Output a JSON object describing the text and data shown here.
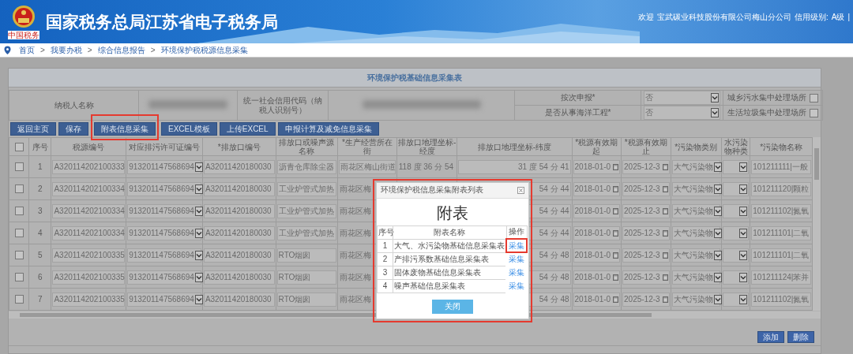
{
  "header": {
    "title": "国家税务总局江苏省电子税务局",
    "logo_caption": "中国税务",
    "welcome": "欢迎",
    "company": "宝武碳业科技股份有限公司梅山分公司",
    "credit_label": "信用级别:",
    "credit_level": "A级",
    "separator": "|"
  },
  "breadcrumb": [
    {
      "label": "首页"
    },
    {
      "separator": ">",
      "label": "我要办税"
    },
    {
      "separator": ">",
      "label": "综合信息报告"
    },
    {
      "separator": ">",
      "label": "环境保护税税源信息采集"
    }
  ],
  "form": {
    "title": "环境保护税基础信息采集表",
    "taxpayer_name_label": "纳税人名称",
    "credit_code_label": "统一社会信用代码（纳税人识别号）",
    "fields": [
      {
        "label": "按次申报*",
        "value": "否"
      },
      {
        "label": "是否从事海洋工程*",
        "value": "否"
      }
    ],
    "checks": [
      {
        "label": "城乡污水集中处理场所",
        "checked": false
      },
      {
        "label": "生活垃圾集中处理场所",
        "checked": false
      }
    ]
  },
  "toolbar": [
    {
      "label": "返回主页",
      "highlighted": false
    },
    {
      "label": "保存",
      "highlighted": false
    },
    {
      "label": "附表信息采集",
      "highlighted": true
    },
    {
      "label": "EXCEL模板",
      "highlighted": false
    },
    {
      "label": "上传EXCEL",
      "highlighted": false
    },
    {
      "label": "申报计算及减免信息采集",
      "highlighted": false
    }
  ],
  "table": {
    "all_checked": false,
    "columns": [
      "序号",
      "税源编号",
      "对应排污许可证编号",
      "*排放口编号",
      "排放口或噪声源名称",
      "*生产经营所在街",
      "排放口地理坐标-经度",
      "排放口地理坐标-纬度",
      "*税源有效期起",
      "*税源有效期止",
      "*污染物类别",
      "水污染物种类",
      "*污染物名称"
    ],
    "rows": [
      {
        "checked": false,
        "seq": "1",
        "source_id": "A320114202100333",
        "permit": "913201147568694",
        "outlet": "A32011420180030",
        "name": "沥青仓库除尘器",
        "street": "雨花区梅山街道",
        "longitude": "118 度 36 分 54",
        "latitude": "31 度 54 分 41",
        "start": "2018-01-0",
        "end": "2025-12-3",
        "category": "大气污染物",
        "pollutant": "101211111|一般"
      },
      {
        "checked": false,
        "seq": "2",
        "source_id": "A320114202100334",
        "permit": "913201147568694",
        "outlet": "A32011420180030",
        "name": "工业炉管式加热",
        "street": "雨花区梅",
        "latitude": "54 分 44",
        "start": "2018-01-0",
        "end": "2025-12-3",
        "category": "大气污染物",
        "pollutant": "101211120|颗粒"
      },
      {
        "checked": false,
        "seq": "3",
        "source_id": "A320114202100334",
        "permit": "913201147568694",
        "outlet": "A32011420180030",
        "name": "工业炉管式加热",
        "street": "雨花区梅",
        "latitude": "54 分 44",
        "start": "2018-01-0",
        "end": "2025-12-3",
        "category": "大气污染物",
        "pollutant": "101211102|氮氧"
      },
      {
        "checked": false,
        "seq": "4",
        "source_id": "A320114202100334",
        "permit": "913201147568694",
        "outlet": "A32011420180030",
        "name": "工业炉管式加热",
        "street": "雨花区梅",
        "latitude": "54 分 44",
        "start": "2018-01-0",
        "end": "2025-12-3",
        "category": "大气污染物",
        "pollutant": "101211101|二氧"
      },
      {
        "checked": false,
        "seq": "5",
        "source_id": "A320114202100335",
        "permit": "913201147568694",
        "outlet": "A32011420180030",
        "name": "RTO烟囱",
        "street": "雨花区梅",
        "latitude": "54 分 48",
        "start": "2018-01-0",
        "end": "2025-12-3",
        "category": "大气污染物",
        "pollutant": "101211101|二氧"
      },
      {
        "checked": false,
        "seq": "6",
        "source_id": "A320114202100335",
        "permit": "913201147568694",
        "outlet": "A32011420180030",
        "name": "RTO烟囱",
        "street": "雨花区梅",
        "latitude": "54 分 48",
        "start": "2018-01-0",
        "end": "2025-12-3",
        "category": "大气污染物",
        "pollutant": "101211124|苯并"
      },
      {
        "checked": false,
        "seq": "7",
        "source_id": "A320114202100335",
        "permit": "913201147568694",
        "outlet": "A32011420180030",
        "name": "RTO烟囱",
        "street": "雨花区梅",
        "latitude": "54 分 48",
        "start": "2018-01-0",
        "end": "2025-12-3",
        "category": "大气污染物",
        "pollutant": "101211102|氮氧"
      }
    ]
  },
  "row_actions": [
    "添加",
    "删除"
  ],
  "dialog": {
    "highlighted": true,
    "title": "环境保护税信息采集附表列表",
    "heading": "附表",
    "columns": [
      "序号",
      "附表名称",
      "操作"
    ],
    "rows": [
      {
        "seq": "1",
        "name": "大气、水污染物基础信息采集表",
        "action": "采集",
        "highlighted": true
      },
      {
        "seq": "2",
        "name": "产排污系数基础信息采集表",
        "action": "采集",
        "highlighted": false
      },
      {
        "seq": "3",
        "name": "固体废物基础信息采集表",
        "action": "采集",
        "highlighted": false
      },
      {
        "seq": "4",
        "name": "噪声基础信息采集表",
        "action": "采集",
        "highlighted": false
      }
    ],
    "button": "关闭"
  }
}
